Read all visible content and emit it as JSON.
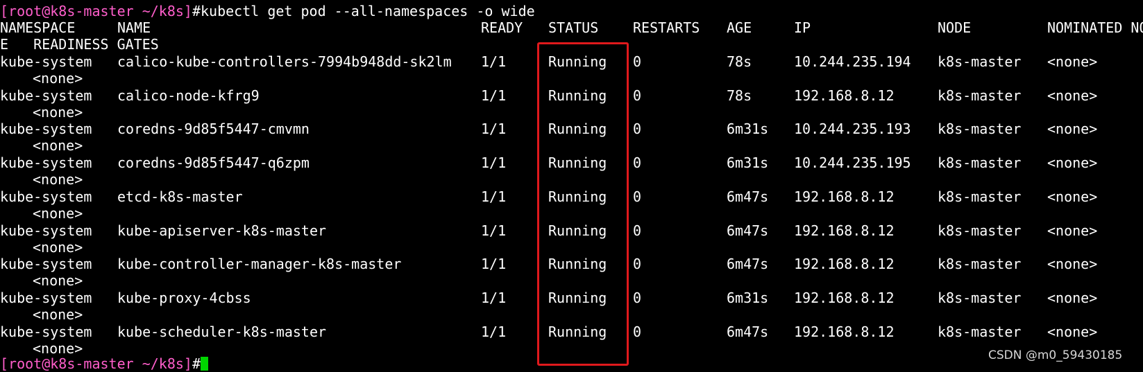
{
  "prompt": {
    "open": "[",
    "user_host": "root@k8s-master",
    "path": " ~/k8s",
    "close": "]",
    "hash": "#"
  },
  "command": "kubectl get pod --all-namespaces -o wide",
  "header": {
    "namespace": "NAMESPACE",
    "name": "NAME",
    "ready": "READY",
    "status": "STATUS",
    "restarts": "RESTARTS",
    "age": "AGE",
    "ip": "IP",
    "node": "NODE",
    "nominated": "NOMINATED NO",
    "wrap": "E   READINESS GATES"
  },
  "rows": [
    {
      "namespace": "kube-system",
      "name": "calico-kube-controllers-7994b948dd-sk2lm",
      "ready": "1/1",
      "status": "Running",
      "restarts": "0",
      "age": "78s",
      "ip": "10.244.235.194",
      "node": "k8s-master",
      "nominated": "<none>",
      "gates": "<none>"
    },
    {
      "namespace": "kube-system",
      "name": "calico-node-kfrg9",
      "ready": "1/1",
      "status": "Running",
      "restarts": "0",
      "age": "78s",
      "ip": "192.168.8.12",
      "node": "k8s-master",
      "nominated": "<none>",
      "gates": "<none>"
    },
    {
      "namespace": "kube-system",
      "name": "coredns-9d85f5447-cmvmn",
      "ready": "1/1",
      "status": "Running",
      "restarts": "0",
      "age": "6m31s",
      "ip": "10.244.235.193",
      "node": "k8s-master",
      "nominated": "<none>",
      "gates": "<none>"
    },
    {
      "namespace": "kube-system",
      "name": "coredns-9d85f5447-q6zpm",
      "ready": "1/1",
      "status": "Running",
      "restarts": "0",
      "age": "6m31s",
      "ip": "10.244.235.195",
      "node": "k8s-master",
      "nominated": "<none>",
      "gates": "<none>"
    },
    {
      "namespace": "kube-system",
      "name": "etcd-k8s-master",
      "ready": "1/1",
      "status": "Running",
      "restarts": "0",
      "age": "6m47s",
      "ip": "192.168.8.12",
      "node": "k8s-master",
      "nominated": "<none>",
      "gates": "<none>"
    },
    {
      "namespace": "kube-system",
      "name": "kube-apiserver-k8s-master",
      "ready": "1/1",
      "status": "Running",
      "restarts": "0",
      "age": "6m47s",
      "ip": "192.168.8.12",
      "node": "k8s-master",
      "nominated": "<none>",
      "gates": "<none>"
    },
    {
      "namespace": "kube-system",
      "name": "kube-controller-manager-k8s-master",
      "ready": "1/1",
      "status": "Running",
      "restarts": "0",
      "age": "6m47s",
      "ip": "192.168.8.12",
      "node": "k8s-master",
      "nominated": "<none>",
      "gates": "<none>"
    },
    {
      "namespace": "kube-system",
      "name": "kube-proxy-4cbss",
      "ready": "1/1",
      "status": "Running",
      "restarts": "0",
      "age": "6m31s",
      "ip": "192.168.8.12",
      "node": "k8s-master",
      "nominated": "<none>",
      "gates": "<none>"
    },
    {
      "namespace": "kube-system",
      "name": "kube-scheduler-k8s-master",
      "ready": "1/1",
      "status": "Running",
      "restarts": "0",
      "age": "6m47s",
      "ip": "192.168.8.12",
      "node": "k8s-master",
      "nominated": "<none>",
      "gates": "<none>"
    }
  ],
  "watermark": "CSDN @m0_59430185",
  "colors": {
    "prompt": "#ff5ecb",
    "highlight_box": "#e0191c",
    "cursor": "#00d600",
    "background": "#000000",
    "text": "#ffffff"
  }
}
